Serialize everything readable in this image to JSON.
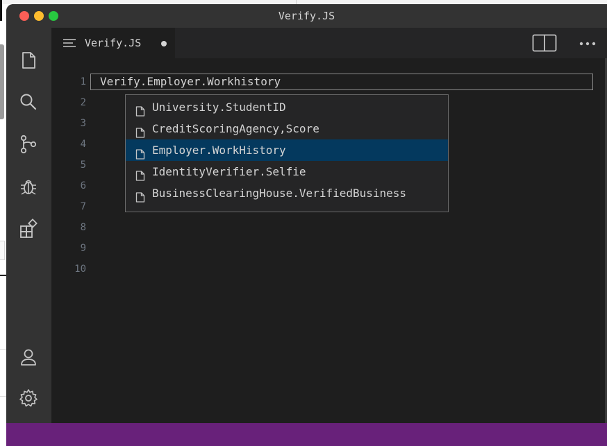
{
  "window": {
    "title": "Verify.JS"
  },
  "tab": {
    "label": "Verify.JS"
  },
  "editor": {
    "line_numbers": [
      "1",
      "2",
      "3",
      "4",
      "5",
      "6",
      "7",
      "8",
      "9",
      "10"
    ],
    "code_line_1": "Verify.Employer.Workhistory"
  },
  "suggestions": [
    {
      "label": "University.StudentID",
      "selected": false
    },
    {
      "label": "CreditScoringAgency,Score",
      "selected": false
    },
    {
      "label": "Employer.WorkHistory",
      "selected": true
    },
    {
      "label": "IdentityVerifier.Selfie",
      "selected": false
    },
    {
      "label": "BusinessClearingHouse.VerifiedBusiness",
      "selected": false
    }
  ],
  "icons": {
    "activity_top": [
      "files-icon",
      "search-icon",
      "source-control-icon",
      "debug-icon",
      "extensions-icon"
    ],
    "activity_bottom": [
      "account-icon",
      "settings-gear-icon"
    ]
  },
  "colors": {
    "statusbar": "#68217a",
    "selection": "#04395e",
    "titlebar": "#333333",
    "editor_bg": "#1e1e1e"
  }
}
